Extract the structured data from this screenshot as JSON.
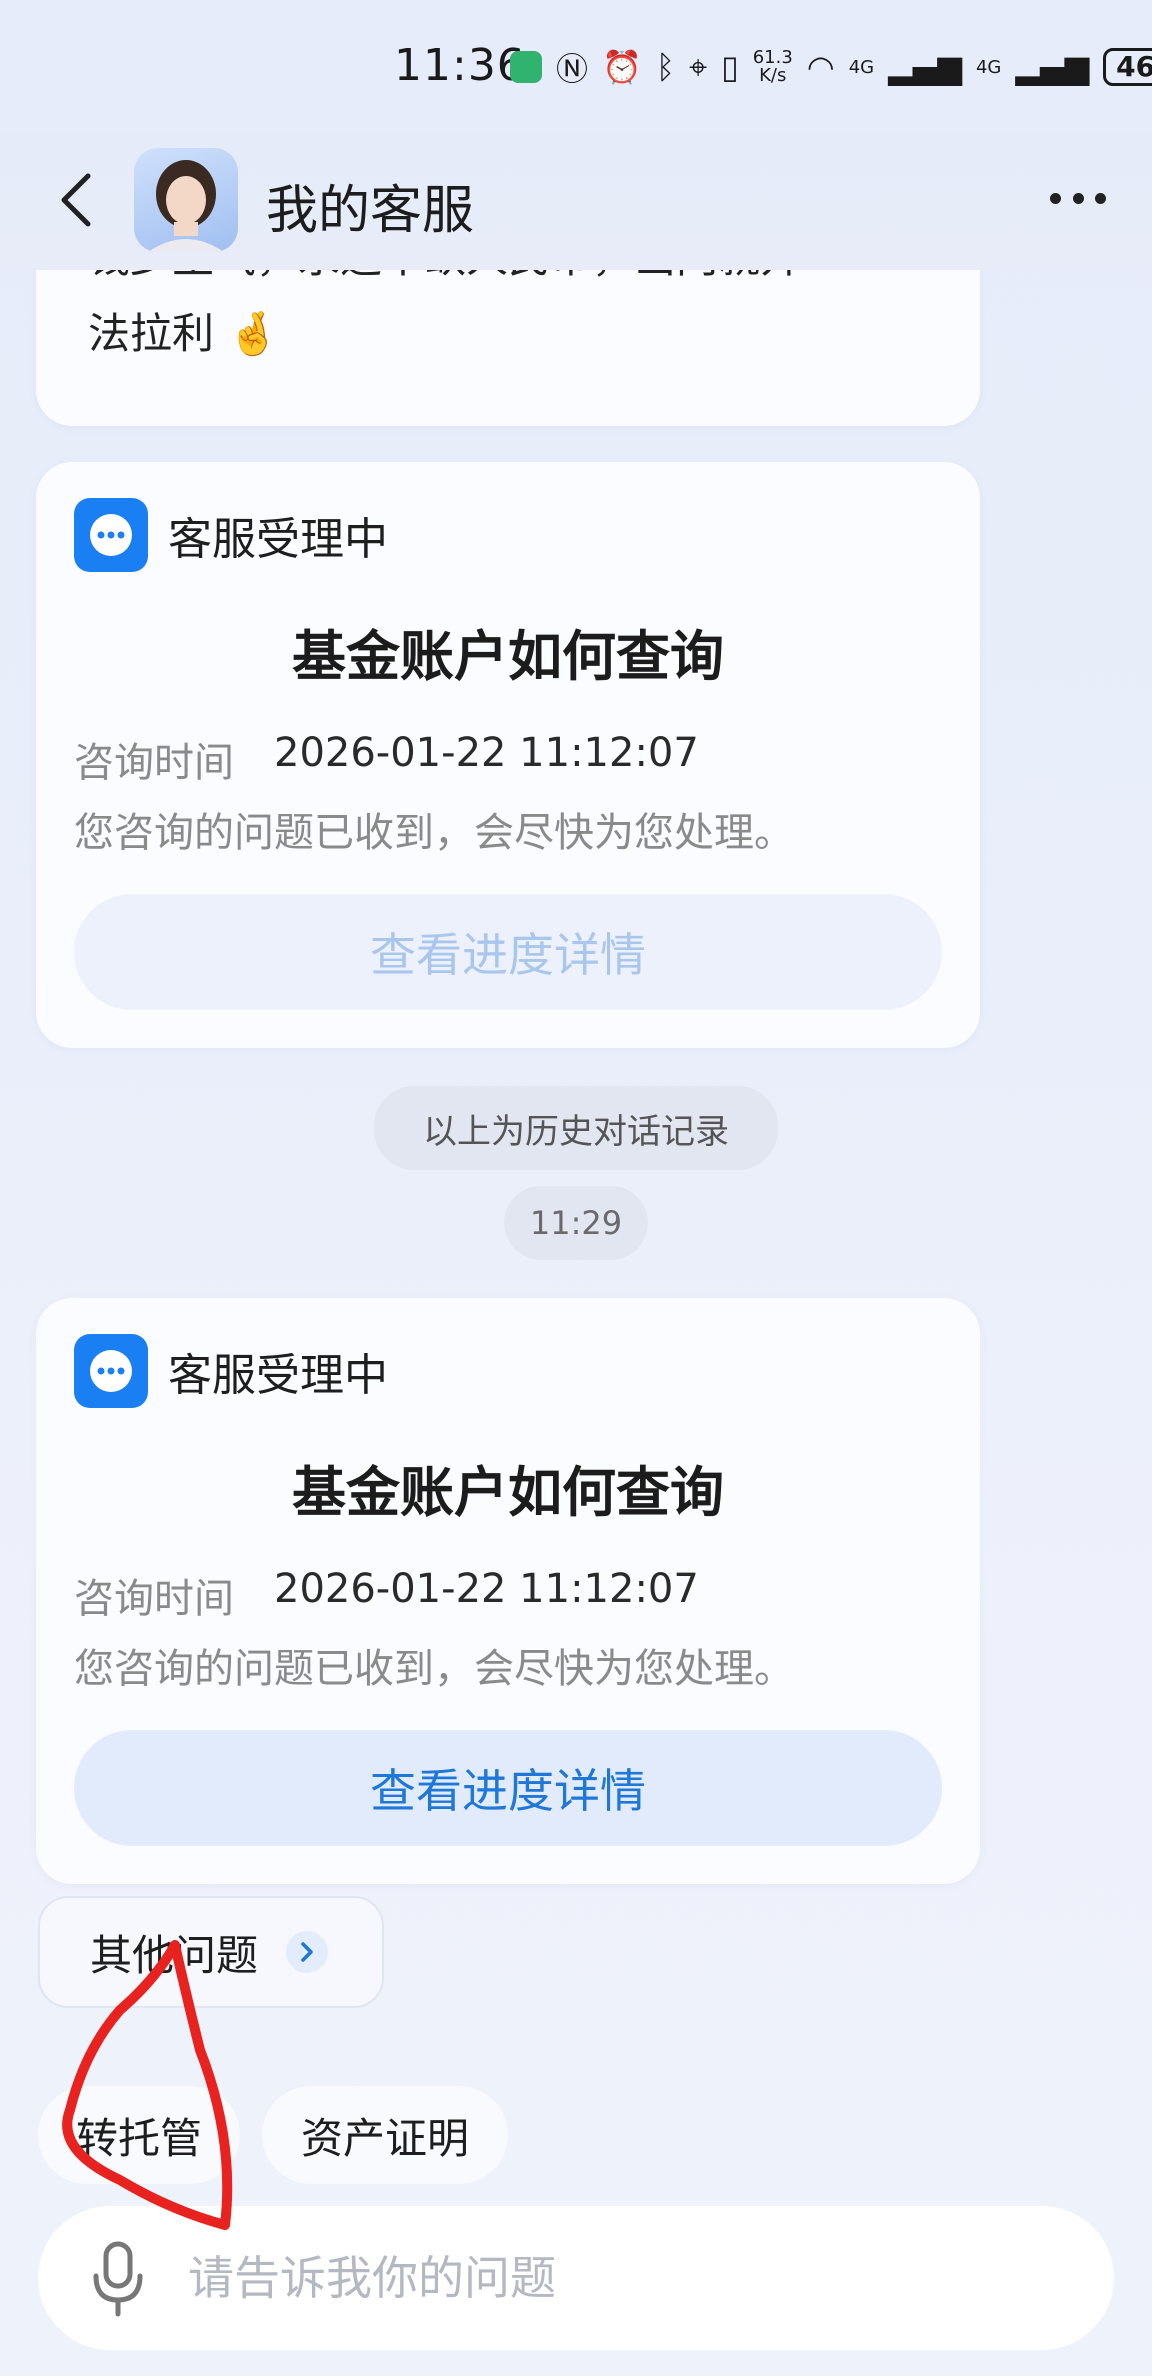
{
  "status_bar": {
    "time": "11:36",
    "net_speed_value": "61.3",
    "net_speed_unit": "K/s",
    "signal_label": "4G",
    "signal_label_2": "4G",
    "battery": "46"
  },
  "header": {
    "title": "我的客服"
  },
  "messages": {
    "truncated_line1": "钱少生气，永远不缺人民币，出门就开",
    "truncated_line2": "法拉利 🤞"
  },
  "service_cards": [
    {
      "status_label": "客服受理中",
      "title": "基金账户如何查询",
      "time_label": "咨询时间",
      "time_value": "2026-01-22 11:12:07",
      "message": "您咨询的问题已收到，会尽快为您处理。",
      "button_label": "查看进度详情"
    },
    {
      "status_label": "客服受理中",
      "title": "基金账户如何查询",
      "time_label": "咨询时间",
      "time_value": "2026-01-22 11:12:07",
      "message": "您咨询的问题已收到，会尽快为您处理。",
      "button_label": "查看进度详情"
    }
  ],
  "history_divider": "以上为历史对话记录",
  "timestamp": "11:29",
  "other_questions": "其他问题",
  "quick_actions": [
    "转托管",
    "资产证明"
  ],
  "input": {
    "placeholder": "请告诉我你的问题"
  },
  "colors": {
    "accent": "#1a7ff2",
    "button_text": "#1f77d8",
    "annotation": "#e8231f"
  }
}
